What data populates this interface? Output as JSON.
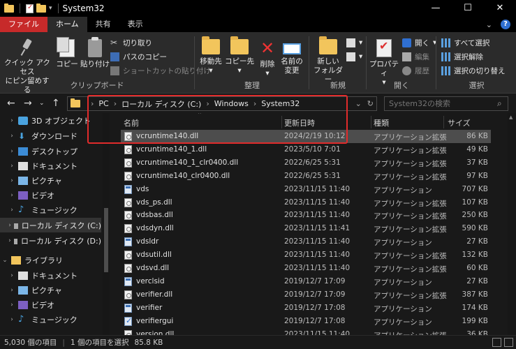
{
  "window": {
    "title": "System32",
    "controls": {
      "minimize": "—",
      "maximize": "☐",
      "close": "✕"
    }
  },
  "ribbon_tabs": [
    {
      "label": "ファイル"
    },
    {
      "label": "ホーム"
    },
    {
      "label": "共有"
    },
    {
      "label": "表示"
    }
  ],
  "ribbon": {
    "clipboard": {
      "label": "クリップボード",
      "pin_line1": "クイック アクセス",
      "pin_line2": "にピン留めする",
      "copy": "コピー",
      "paste": "貼り付け",
      "cut": "切り取り",
      "copy_path": "パスのコピー",
      "paste_shortcut": "ショートカットの貼り付け"
    },
    "organize": {
      "label": "整理",
      "move_to": "移動先",
      "copy_to": "コピー先",
      "delete": "削除",
      "rename_line1": "名前の",
      "rename_line2": "変更"
    },
    "new": {
      "label": "新規",
      "new_folder_line1": "新しい",
      "new_folder_line2": "フォルダー"
    },
    "open": {
      "label": "開く",
      "properties": "プロパティ",
      "open": "開く",
      "edit": "編集",
      "history": "履歴"
    },
    "select": {
      "label": "選択",
      "select_all": "すべて選択",
      "select_none": "選択解除",
      "invert": "選択の切り替え"
    }
  },
  "address": {
    "breadcrumbs": [
      "PC",
      "ローカル ディスク (C:)",
      "Windows",
      "System32"
    ],
    "search_placeholder": "System32の検索"
  },
  "nav_pane": {
    "items": [
      {
        "label": "3D オブジェクト",
        "icon": "cube-icon"
      },
      {
        "label": "ダウンロード",
        "icon": "download-icon"
      },
      {
        "label": "デスクトップ",
        "icon": "desktop-icon"
      },
      {
        "label": "ドキュメント",
        "icon": "document-icon"
      },
      {
        "label": "ピクチャ",
        "icon": "pictures-icon"
      },
      {
        "label": "ビデオ",
        "icon": "video-icon"
      },
      {
        "label": "ミュージック",
        "icon": "music-icon"
      },
      {
        "label": "ローカル ディスク (C:)",
        "icon": "drive-icon"
      },
      {
        "label": "ローカル ディスク (D:)",
        "icon": "drive-icon"
      },
      {
        "label": "ライブラリ",
        "icon": "library-icon"
      },
      {
        "label": "ドキュメント",
        "icon": "document-icon"
      },
      {
        "label": "ピクチャ",
        "icon": "pictures-icon"
      },
      {
        "label": "ビデオ",
        "icon": "video-icon"
      },
      {
        "label": "ミュージック",
        "icon": "music-icon"
      }
    ]
  },
  "file_list": {
    "columns": {
      "name": "名前",
      "date": "更新日時",
      "type": "種類",
      "size": "サイズ"
    },
    "rows": [
      {
        "name": "vcruntime140.dll",
        "date": "2024/2/19 10:12",
        "type": "アプリケーション拡張",
        "size": "86 KB",
        "icon": "dll"
      },
      {
        "name": "vcruntime140_1.dll",
        "date": "2023/5/10 7:01",
        "type": "アプリケーション拡張",
        "size": "49 KB",
        "icon": "dll"
      },
      {
        "name": "vcruntime140_1_clr0400.dll",
        "date": "2022/6/25 5:31",
        "type": "アプリケーション拡張",
        "size": "37 KB",
        "icon": "dll"
      },
      {
        "name": "vcruntime140_clr0400.dll",
        "date": "2022/6/25 5:31",
        "type": "アプリケーション拡張",
        "size": "97 KB",
        "icon": "dll"
      },
      {
        "name": "vds",
        "date": "2023/11/15 11:40",
        "type": "アプリケーション",
        "size": "707 KB",
        "icon": "exe"
      },
      {
        "name": "vds_ps.dll",
        "date": "2023/11/15 11:40",
        "type": "アプリケーション拡張",
        "size": "107 KB",
        "icon": "dll"
      },
      {
        "name": "vdsbas.dll",
        "date": "2023/11/15 11:40",
        "type": "アプリケーション拡張",
        "size": "250 KB",
        "icon": "dll"
      },
      {
        "name": "vdsdyn.dll",
        "date": "2023/11/15 11:41",
        "type": "アプリケーション拡張",
        "size": "590 KB",
        "icon": "dll"
      },
      {
        "name": "vdsldr",
        "date": "2023/11/15 11:40",
        "type": "アプリケーション",
        "size": "27 KB",
        "icon": "exe"
      },
      {
        "name": "vdsutil.dll",
        "date": "2023/11/15 11:40",
        "type": "アプリケーション拡張",
        "size": "132 KB",
        "icon": "dll"
      },
      {
        "name": "vdsvd.dll",
        "date": "2023/11/15 11:40",
        "type": "アプリケーション拡張",
        "size": "60 KB",
        "icon": "dll"
      },
      {
        "name": "verclsid",
        "date": "2019/12/7 17:09",
        "type": "アプリケーション",
        "size": "27 KB",
        "icon": "exe"
      },
      {
        "name": "verifier.dll",
        "date": "2019/12/7 17:09",
        "type": "アプリケーション拡張",
        "size": "387 KB",
        "icon": "dll"
      },
      {
        "name": "verifier",
        "date": "2019/12/7 17:08",
        "type": "アプリケーション",
        "size": "174 KB",
        "icon": "exe"
      },
      {
        "name": "verifiergui",
        "date": "2019/12/7 17:08",
        "type": "アプリケーション",
        "size": "199 KB",
        "icon": "gui"
      },
      {
        "name": "version.dll",
        "date": "2023/11/15 11:40",
        "type": "アプリケーション拡張",
        "size": "36 KB",
        "icon": "dll"
      }
    ]
  },
  "status": {
    "count": "5,030 個の項目",
    "selected": "1 個の項目を選択",
    "size": "85.8 KB"
  }
}
